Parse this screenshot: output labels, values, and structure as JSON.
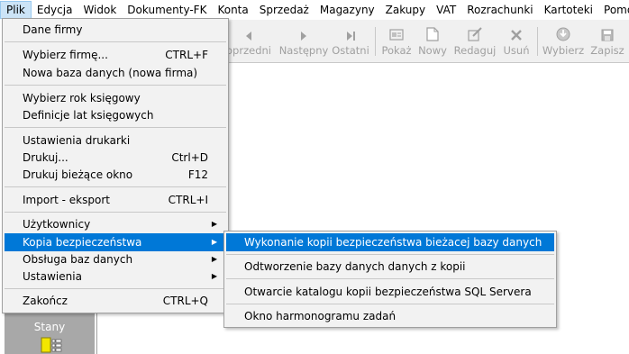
{
  "menubar": {
    "items": [
      "Plik",
      "Edycja",
      "Widok",
      "Dokumenty-FK",
      "Konta",
      "Sprzedaż",
      "Magazyny",
      "Zakupy",
      "VAT",
      "Rozrachunki",
      "Kartoteki",
      "Pomoc"
    ],
    "active_index": 0
  },
  "toolbar": {
    "buttons": [
      {
        "label": "oprzedni",
        "icon": "arrow-left-icon"
      },
      {
        "label": "Następny",
        "icon": "arrow-right-icon"
      },
      {
        "label": "Ostatni",
        "icon": "last-icon"
      },
      {
        "label": "Pokaż",
        "icon": "show-icon"
      },
      {
        "label": "Nowy",
        "icon": "new-icon"
      },
      {
        "label": "Redaguj",
        "icon": "edit-icon"
      },
      {
        "label": "Usuń",
        "icon": "delete-icon"
      },
      {
        "label": "Wybierz",
        "icon": "select-icon"
      },
      {
        "label": "Zapisz",
        "icon": "save-icon"
      }
    ]
  },
  "left_panel": {
    "tile_label": "Stany"
  },
  "plik_menu": {
    "items": [
      {
        "label": "Dane firmy",
        "shortcut": "",
        "submenu": false
      },
      {
        "label": "Wybierz firmę...",
        "shortcut": "CTRL+F",
        "submenu": false
      },
      {
        "label": "Nowa baza danych (nowa firma)",
        "shortcut": "",
        "submenu": false
      },
      {
        "label": "Wybierz rok księgowy",
        "shortcut": "",
        "submenu": false
      },
      {
        "label": "Definicje lat księgowych",
        "shortcut": "",
        "submenu": false
      },
      {
        "label": "Ustawienia drukarki",
        "shortcut": "",
        "submenu": false
      },
      {
        "label": "Drukuj...",
        "shortcut": "Ctrl+D",
        "submenu": false
      },
      {
        "label": "Drukuj bieżące okno",
        "shortcut": "F12",
        "submenu": false
      },
      {
        "label": "Import - eksport",
        "shortcut": "CTRL+I",
        "submenu": false
      },
      {
        "label": "Użytkownicy",
        "shortcut": "",
        "submenu": true
      },
      {
        "label": "Kopia bezpieczeństwa",
        "shortcut": "",
        "submenu": true
      },
      {
        "label": "Obsługa baz danych",
        "shortcut": "",
        "submenu": true
      },
      {
        "label": "Ustawienia",
        "shortcut": "",
        "submenu": true
      },
      {
        "label": "Zakończ",
        "shortcut": "CTRL+Q",
        "submenu": false
      }
    ],
    "highlighted_index": 10
  },
  "backup_submenu": {
    "items": [
      "Wykonanie kopii bezpieczeństwa bieżacej bazy danych",
      "Odtworzenie bazy danych  danych z kopii",
      "Otwarcie katalogu kopii bezpieczeństwa SQL Servera",
      "Okno harmonogramu zadań"
    ],
    "highlighted_index": 0
  },
  "colors": {
    "highlight": "#0078d7",
    "menu_bg": "#f2f2f2",
    "menubar_active": "#cce4f7",
    "disabled_text": "#a0a0a0",
    "tile_bg": "#a8a8a8"
  }
}
